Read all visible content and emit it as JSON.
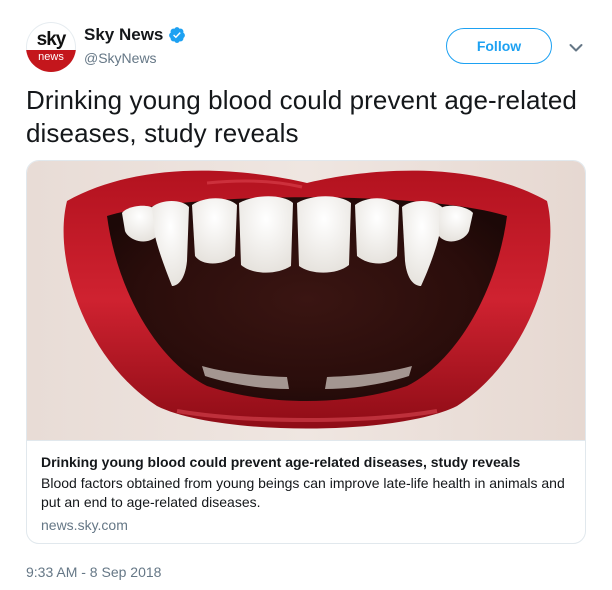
{
  "author": {
    "display_name": "Sky News",
    "handle": "@SkyNews",
    "avatar_logo_top": "sky",
    "avatar_logo_bottom": "news",
    "verified_icon": "verified-badge-icon",
    "brand_color": "#c4161c"
  },
  "actions": {
    "follow_label": "Follow",
    "more_icon": "chevron-down-icon",
    "accent_color": "#1da1f2"
  },
  "tweet": {
    "text": "Drinking young blood could prevent age-related diseases, study reveals",
    "timestamp": "9:33 AM - 8 Sep 2018"
  },
  "card": {
    "image_subject": "red lips with vampire fangs",
    "title": "Drinking young blood could prevent age-related diseases, study reveals",
    "description": "Blood factors obtained from young beings can improve late-life health in animals and put an end to age-related diseases.",
    "domain": "news.sky.com"
  }
}
